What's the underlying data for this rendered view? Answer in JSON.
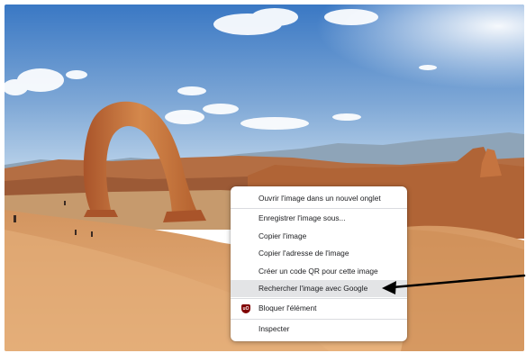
{
  "photo": {
    "subject": "Delicate Arch, desert landscape"
  },
  "context_menu": {
    "items": [
      {
        "label": "Ouvrir l'image dans un nouvel onglet"
      },
      {
        "label": "Enregistrer l'image sous..."
      },
      {
        "label": "Copier l'image"
      },
      {
        "label": "Copier l'adresse de l'image"
      },
      {
        "label": "Créer un code QR pour cette image"
      },
      {
        "label": "Rechercher l'image avec Google",
        "highlighted": true
      },
      {
        "label": "Bloquer l'élément",
        "icon": "ublock-shield-icon",
        "icon_text": "uO"
      },
      {
        "label": "Inspecter"
      }
    ]
  },
  "colors": {
    "sky_top": "#3a78c4",
    "sky_bottom": "#bcd5ec",
    "rock": "#c9763f",
    "sand": "#dca06b",
    "menu_highlight": "#e3e4e6",
    "ublock_red": "#800000",
    "arrow": "#000000"
  }
}
